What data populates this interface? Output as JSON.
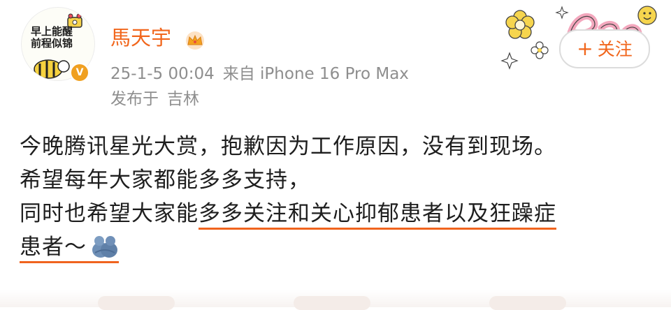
{
  "user": {
    "avatar_text_line1": "早上能醒",
    "avatar_text_line2": "前程似锦",
    "name": "馬天宇",
    "verified_icon": "v-badge-icon",
    "level_icon": "crown-icon"
  },
  "meta": {
    "timestamp": "25-1-5 00:04",
    "source": "来自 iPhone 16 Pro Max",
    "location_prefix": "发布于",
    "location": "吉林"
  },
  "follow": {
    "plus": "+",
    "label": "关注"
  },
  "post": {
    "line1": "今晚腾讯星光大赏，抱歉因为工作原因，没有到现场。",
    "line2": "希望每年大家都能多多支持，",
    "line3_plain": "同时也希望大家能",
    "line3_underlined": "多多关注和关心抑郁患者以及狂躁症",
    "line4_underlined": "患者～",
    "emoji_icon": "hug-emoji-icon"
  },
  "colors": {
    "accent": "#f1661c",
    "underline": "#f0641e",
    "meta": "#8e8e8e",
    "badge": "#f0a020"
  }
}
